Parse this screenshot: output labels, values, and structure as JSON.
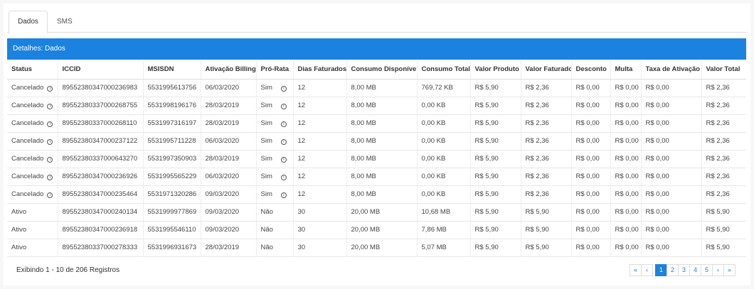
{
  "tabs": [
    {
      "label": "Dados",
      "active": true
    },
    {
      "label": "SMS",
      "active": false
    }
  ],
  "panel_title": "Detalhes: Dados",
  "columns": [
    "Status",
    "ICCID",
    "MSISDN",
    "Ativação Billing",
    "Pró-Rata",
    "Dias Faturados",
    "Consumo Disponível",
    "Consumo Total",
    "Valor Produto",
    "Valor Faturado",
    "Desconto",
    "Multa",
    "Taxa de Ativação",
    "Valor Total"
  ],
  "rows": [
    {
      "status": "Cancelado",
      "status_info": true,
      "iccid": "89552380347000236983",
      "msisdn": "5531995613756",
      "ativacao": "06/03/2020",
      "prorata": "Sim",
      "prorata_info": true,
      "dias": "12",
      "disp": "8,00 MB",
      "total": "769,72 KB",
      "vproduto": "R$ 5,90",
      "vfaturado": "R$ 2,36",
      "desconto": "R$ 0,00",
      "multa": "R$ 0,00",
      "taxa": "R$ 0,00",
      "vtotal": "R$ 2,36"
    },
    {
      "status": "Cancelado",
      "status_info": true,
      "iccid": "89552380337000268755",
      "msisdn": "5531998196176",
      "ativacao": "28/03/2019",
      "prorata": "Sim",
      "prorata_info": true,
      "dias": "12",
      "disp": "8,00 MB",
      "total": "0,00 KB",
      "vproduto": "R$ 5,90",
      "vfaturado": "R$ 2,36",
      "desconto": "R$ 0,00",
      "multa": "R$ 0,00",
      "taxa": "R$ 0,00",
      "vtotal": "R$ 2,36"
    },
    {
      "status": "Cancelado",
      "status_info": true,
      "iccid": "89552380337000268110",
      "msisdn": "5531997316197",
      "ativacao": "28/03/2019",
      "prorata": "Sim",
      "prorata_info": true,
      "dias": "12",
      "disp": "8,00 MB",
      "total": "0,00 KB",
      "vproduto": "R$ 5,90",
      "vfaturado": "R$ 2,36",
      "desconto": "R$ 0,00",
      "multa": "R$ 0,00",
      "taxa": "R$ 0,00",
      "vtotal": "R$ 2,36"
    },
    {
      "status": "Cancelado",
      "status_info": true,
      "iccid": "89552380347000237122",
      "msisdn": "5531995711228",
      "ativacao": "06/03/2020",
      "prorata": "Sim",
      "prorata_info": true,
      "dias": "12",
      "disp": "8,00 MB",
      "total": "0,00 KB",
      "vproduto": "R$ 5,90",
      "vfaturado": "R$ 2,36",
      "desconto": "R$ 0,00",
      "multa": "R$ 0,00",
      "taxa": "R$ 0,00",
      "vtotal": "R$ 2,36"
    },
    {
      "status": "Cancelado",
      "status_info": true,
      "iccid": "89552380337000643270",
      "msisdn": "5531997350903",
      "ativacao": "28/03/2019",
      "prorata": "Sim",
      "prorata_info": true,
      "dias": "12",
      "disp": "8,00 MB",
      "total": "0,00 KB",
      "vproduto": "R$ 5,90",
      "vfaturado": "R$ 2,36",
      "desconto": "R$ 0,00",
      "multa": "R$ 0,00",
      "taxa": "R$ 0,00",
      "vtotal": "R$ 2,36"
    },
    {
      "status": "Cancelado",
      "status_info": true,
      "iccid": "89552380347000236926",
      "msisdn": "5531995565229",
      "ativacao": "06/03/2020",
      "prorata": "Sim",
      "prorata_info": true,
      "dias": "12",
      "disp": "8,00 MB",
      "total": "0,00 KB",
      "vproduto": "R$ 5,90",
      "vfaturado": "R$ 2,36",
      "desconto": "R$ 0,00",
      "multa": "R$ 0,00",
      "taxa": "R$ 0,00",
      "vtotal": "R$ 2,36"
    },
    {
      "status": "Cancelado",
      "status_info": true,
      "iccid": "89552380347000235464",
      "msisdn": "5531971320286",
      "ativacao": "09/03/2020",
      "prorata": "Sim",
      "prorata_info": true,
      "dias": "12",
      "disp": "8,00 MB",
      "total": "0,00 KB",
      "vproduto": "R$ 5,90",
      "vfaturado": "R$ 2,36",
      "desconto": "R$ 0,00",
      "multa": "R$ 0,00",
      "taxa": "R$ 0,00",
      "vtotal": "R$ 2,36"
    },
    {
      "status": "Ativo",
      "status_info": false,
      "iccid": "89552380347000240134",
      "msisdn": "5531999977869",
      "ativacao": "09/03/2020",
      "prorata": "Não",
      "prorata_info": false,
      "dias": "30",
      "disp": "20,00 MB",
      "total": "10,68 MB",
      "vproduto": "R$ 5,90",
      "vfaturado": "R$ 5,90",
      "desconto": "R$ 0,00",
      "multa": "R$ 0,00",
      "taxa": "R$ 0,00",
      "vtotal": "R$ 5,90"
    },
    {
      "status": "Ativo",
      "status_info": false,
      "iccid": "89552380347000236918",
      "msisdn": "5531995546110",
      "ativacao": "09/03/2020",
      "prorata": "Não",
      "prorata_info": false,
      "dias": "30",
      "disp": "20,00 MB",
      "total": "7,86 MB",
      "vproduto": "R$ 5,90",
      "vfaturado": "R$ 5,90",
      "desconto": "R$ 0,00",
      "multa": "R$ 0,00",
      "taxa": "R$ 0,00",
      "vtotal": "R$ 5,90"
    },
    {
      "status": "Ativo",
      "status_info": false,
      "iccid": "89552380337000278333",
      "msisdn": "5531996931673",
      "ativacao": "28/03/2019",
      "prorata": "Não",
      "prorata_info": false,
      "dias": "30",
      "disp": "20,00 MB",
      "total": "5,07 MB",
      "vproduto": "R$ 5,90",
      "vfaturado": "R$ 5,90",
      "desconto": "R$ 0,00",
      "multa": "R$ 0,00",
      "taxa": "R$ 0,00",
      "vtotal": "R$ 5,90"
    }
  ],
  "footer": {
    "summary": "Exibindo 1 - 10 de 206 Registros"
  },
  "pagination": {
    "first": "«",
    "prev": "‹",
    "pages": [
      "1",
      "2",
      "3",
      "4",
      "5"
    ],
    "active_page": "1",
    "next": "›",
    "last": "»"
  },
  "colors": {
    "accent": "#1b82e0"
  }
}
